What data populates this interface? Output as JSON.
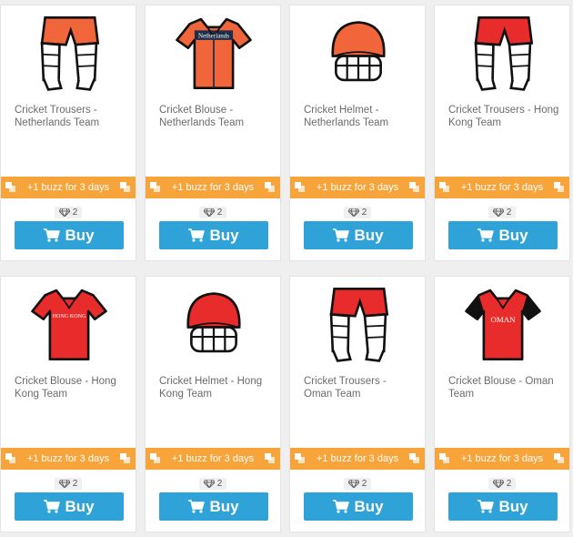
{
  "colors": {
    "orange_kit": "#f0663a",
    "red_kit": "#e82c2c",
    "promo_bg": "#f7a43b",
    "buy_bg": "#2fa3d8"
  },
  "products": [
    {
      "title": "Cricket Trousers - Netherlands Team",
      "icon": "trousers-icon",
      "team": "netherlands",
      "promo": "+1 buzz for 3 days",
      "price": "2",
      "buy": "Buy"
    },
    {
      "title": "Cricket Blouse - Netherlands Team",
      "icon": "shirt-icon",
      "team": "netherlands",
      "shirt_text": "Netherlands",
      "promo": "+1 buzz for 3 days",
      "price": "2",
      "buy": "Buy"
    },
    {
      "title": "Cricket Helmet - Netherlands Team",
      "icon": "helmet-icon",
      "team": "netherlands",
      "promo": "+1 buzz for 3 days",
      "price": "2",
      "buy": "Buy"
    },
    {
      "title": "Cricket Trousers - Hong Kong Team",
      "icon": "trousers-icon",
      "team": "hongkong",
      "promo": "+1 buzz for 3 days",
      "price": "2",
      "buy": "Buy"
    },
    {
      "title": "Cricket Blouse - Hong Kong Team",
      "icon": "shirt-icon",
      "team": "hongkong",
      "shirt_text": "HONG KONG",
      "promo": "+1 buzz for 3 days",
      "price": "2",
      "buy": "Buy"
    },
    {
      "title": "Cricket Helmet - Hong Kong Team",
      "icon": "helmet-icon",
      "team": "hongkong",
      "promo": "+1 buzz for 3 days",
      "price": "2",
      "buy": "Buy"
    },
    {
      "title": "Cricket Trousers - Oman Team",
      "icon": "trousers-icon",
      "team": "oman",
      "promo": "+1 buzz for 3 days",
      "price": "2",
      "buy": "Buy"
    },
    {
      "title": "Cricket Blouse - Oman Team",
      "icon": "shirt-icon",
      "team": "oman",
      "shirt_text": "OMAN",
      "promo": "+1 buzz for 3 days",
      "price": "2",
      "buy": "Buy"
    }
  ]
}
